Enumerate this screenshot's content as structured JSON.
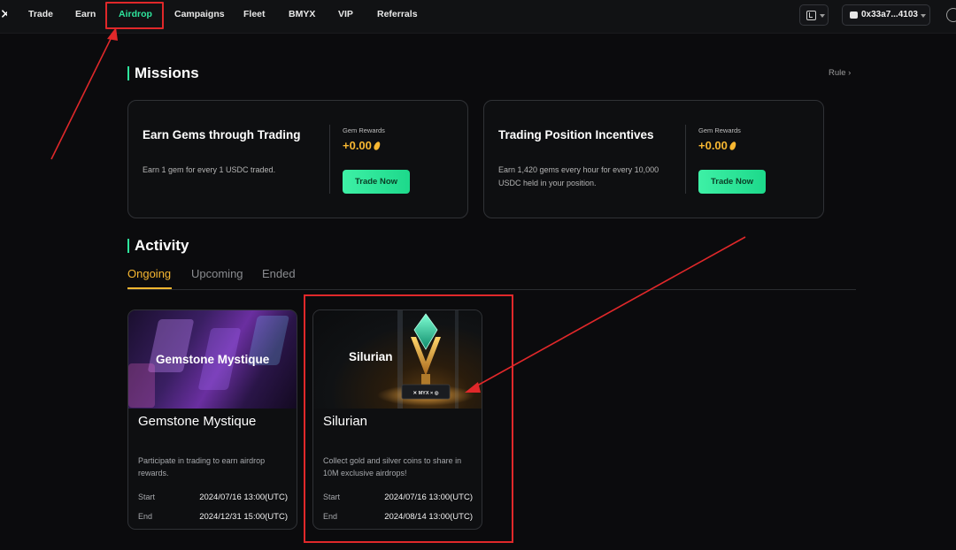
{
  "nav": {
    "items": [
      {
        "label": "Trade",
        "active": false
      },
      {
        "label": "Earn",
        "active": false
      },
      {
        "label": "Airdrop",
        "active": true
      },
      {
        "label": "Campaigns",
        "active": false
      },
      {
        "label": "Fleet",
        "active": false
      },
      {
        "label": "BMYX",
        "active": false
      },
      {
        "label": "VIP",
        "active": false
      },
      {
        "label": "Referrals",
        "active": false
      }
    ],
    "wallet_address": "0x33a7...4103"
  },
  "missions": {
    "title": "Missions",
    "rule_label": "Rule ›",
    "cards": [
      {
        "title": "Earn Gems through Trading",
        "description": "Earn 1 gem for every 1 USDC traded.",
        "reward_label": "Gem Rewards",
        "reward_value": "+0.00",
        "button_label": "Trade Now"
      },
      {
        "title": "Trading Position Incentives",
        "description": "Earn 1,420 gems every hour for every 10,000 USDC held in your position.",
        "reward_label": "Gem Rewards",
        "reward_value": "+0.00",
        "button_label": "Trade Now"
      }
    ]
  },
  "activity": {
    "title": "Activity",
    "tabs": [
      {
        "label": "Ongoing",
        "active": true
      },
      {
        "label": "Upcoming",
        "active": false
      },
      {
        "label": "Ended",
        "active": false
      }
    ],
    "cards": [
      {
        "banner_text": "Gemstone Mystique",
        "name": "Gemstone Mystique",
        "description": "Participate in trading to earn airdrop rewards.",
        "start_label": "Start",
        "start_value": "2024/07/16 13:00(UTC)",
        "end_label": "End",
        "end_value": "2024/12/31 15:00(UTC)"
      },
      {
        "banner_text": "Silurian",
        "banner_logo_text": "✕ MYX × ◎",
        "name": "Silurian",
        "description": "Collect gold and silver coins to share in 10M exclusive airdrops!",
        "start_label": "Start",
        "start_value": "2024/07/16 13:00(UTC)",
        "end_label": "End",
        "end_value": "2024/08/14 13:00(UTC)"
      }
    ]
  },
  "colors": {
    "accent_green": "#2ee59d",
    "accent_gold": "#f7b731",
    "annotation_red": "#e0282a",
    "background": "#0b0b0d"
  }
}
